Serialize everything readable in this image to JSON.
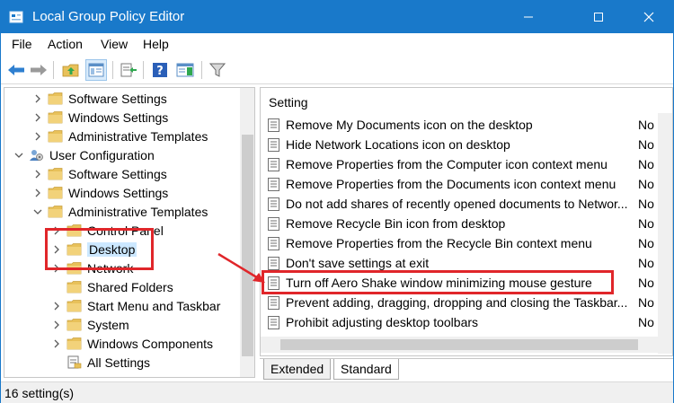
{
  "window": {
    "title": "Local Group Policy Editor",
    "accent": "#1979ca"
  },
  "menu": [
    {
      "label": "File"
    },
    {
      "label": "Action"
    },
    {
      "label": "View"
    },
    {
      "label": "Help"
    }
  ],
  "toolbar": {
    "icons": [
      "back-arrow-icon",
      "forward-arrow-icon",
      "up-folder-icon",
      "show-hide-tree-icon",
      "export-list-icon",
      "help-icon",
      "show-pane-icon",
      "filter-icon"
    ]
  },
  "tree": {
    "items": [
      {
        "label": "Software Settings",
        "expander": "collapsed",
        "icon": "folder"
      },
      {
        "label": "Windows Settings",
        "expander": "collapsed",
        "icon": "folder"
      },
      {
        "label": "Administrative Templates",
        "expander": "collapsed",
        "icon": "folder"
      },
      {
        "label": "User Configuration",
        "expander": "expanded",
        "icon": "user-config"
      },
      {
        "label": "Software Settings",
        "expander": "collapsed",
        "icon": "folder"
      },
      {
        "label": "Windows Settings",
        "expander": "collapsed",
        "icon": "folder"
      },
      {
        "label": "Administrative Templates",
        "expander": "expanded",
        "icon": "folder"
      },
      {
        "label": "Control Panel",
        "expander": "collapsed",
        "icon": "folder"
      },
      {
        "label": "Desktop",
        "expander": "collapsed",
        "icon": "folder",
        "selected": true
      },
      {
        "label": "Network",
        "expander": "collapsed",
        "icon": "folder"
      },
      {
        "label": "Shared Folders",
        "expander": "none",
        "icon": "folder"
      },
      {
        "label": "Start Menu and Taskbar",
        "expander": "collapsed",
        "icon": "folder"
      },
      {
        "label": "System",
        "expander": "collapsed",
        "icon": "folder"
      },
      {
        "label": "Windows Components",
        "expander": "collapsed",
        "icon": "folder"
      },
      {
        "label": "All Settings",
        "expander": "none",
        "icon": "all-settings"
      }
    ]
  },
  "list": {
    "column_setting": "Setting",
    "rows": [
      {
        "name": "Remove My Documents icon on the desktop",
        "state": "No"
      },
      {
        "name": "Hide Network Locations icon on desktop",
        "state": "No"
      },
      {
        "name": "Remove Properties from the Computer icon context menu",
        "state": "No"
      },
      {
        "name": "Remove Properties from the Documents icon context menu",
        "state": "No"
      },
      {
        "name": "Do not add shares of recently opened documents to Networ...",
        "state": "No"
      },
      {
        "name": "Remove Recycle Bin icon from desktop",
        "state": "No"
      },
      {
        "name": "Remove Properties from the Recycle Bin context menu",
        "state": "No"
      },
      {
        "name": "Don't save settings at exit",
        "state": "No"
      },
      {
        "name": "Turn off Aero Shake window minimizing mouse gesture",
        "state": "No",
        "highlighted": true
      },
      {
        "name": "Prevent adding, dragging, dropping and closing the Taskbar...",
        "state": "No"
      },
      {
        "name": "Prohibit adjusting desktop toolbars",
        "state": "No"
      }
    ]
  },
  "tabs": [
    {
      "label": "Extended",
      "active": false
    },
    {
      "label": "Standard",
      "active": true
    }
  ],
  "status": {
    "text": "16 setting(s)"
  },
  "colors": {
    "annotation": "#e0262a",
    "folder": "#e8c15a",
    "selection": "#cce8ff"
  }
}
